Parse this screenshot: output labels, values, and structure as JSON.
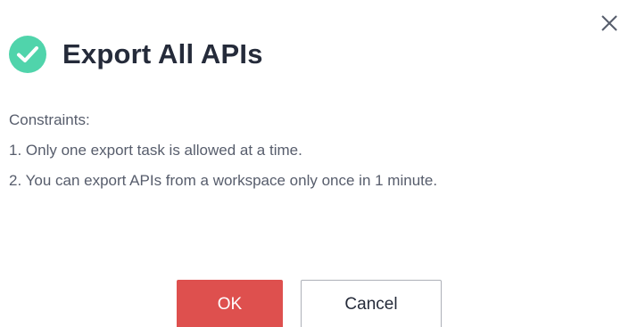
{
  "dialog": {
    "title": "Export All APIs",
    "status_icon": "check-circle-icon",
    "close_icon": "close-icon",
    "accent_color": "#50d4ab",
    "constraints_heading": "Constraints:",
    "constraints": [
      "1. Only one export task is allowed at a time.",
      "2. You can export APIs from a workspace only once in 1 minute."
    ],
    "ok_label": "OK",
    "cancel_label": "Cancel",
    "ok_color": "#de504e"
  }
}
